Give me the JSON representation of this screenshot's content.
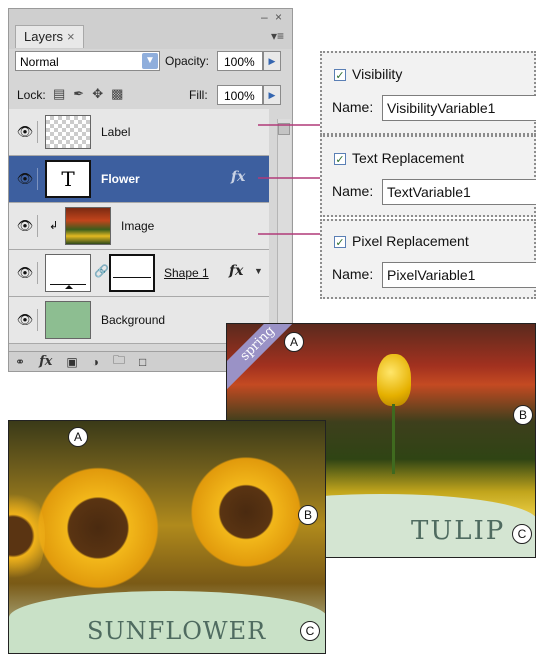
{
  "panel": {
    "tab_label": "Layers",
    "tab_close": "×",
    "minimize": "–",
    "close": "×",
    "menu_icon": "▾≡",
    "blend_mode": "Normal",
    "opacity_label": "Opacity:",
    "opacity_value": "100%",
    "lock_label": "Lock:",
    "fill_label": "Fill:",
    "fill_value": "100%",
    "layers": [
      {
        "name": "Label"
      },
      {
        "name": "Flower",
        "thumb_glyph": "T",
        "fx": "fx"
      },
      {
        "name": "Image"
      },
      {
        "name": "Shape 1",
        "fx": "fx"
      },
      {
        "name": "Background"
      }
    ],
    "bottom_icons": [
      "link-icon",
      "fx-icon",
      "mask-icon",
      "adjustment-icon",
      "folder-icon",
      "new-layer-icon"
    ],
    "bottom_fx": "fx"
  },
  "variables": [
    {
      "checkbox_label": "Visibility",
      "name_label": "Name:",
      "name_value": "VisibilityVariable1"
    },
    {
      "checkbox_label": "Text Replacement",
      "name_label": "Name:",
      "name_value": "TextVariable1"
    },
    {
      "checkbox_label": "Pixel Replacement",
      "name_label": "Name:",
      "name_value": "PixelVariable1"
    }
  ],
  "tulip_card": {
    "banner": "spring",
    "caption": "TULIP",
    "markers": [
      "A",
      "B",
      "C"
    ]
  },
  "sunflower_card": {
    "caption": "SUNFLOWER",
    "markers": [
      "A",
      "B",
      "C"
    ]
  },
  "colors": {
    "selection": "#3d5f9f",
    "connector": "#b03a78",
    "background_thumb": "#8dbe91",
    "caption_text": "#4f6b60"
  }
}
